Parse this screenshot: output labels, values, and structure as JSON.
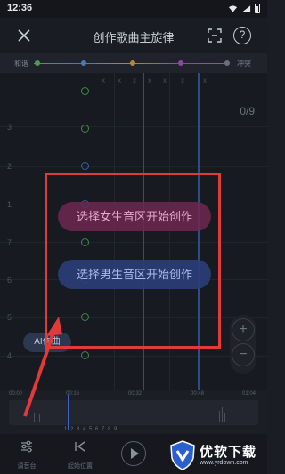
{
  "status_bar": {
    "time": "12:36"
  },
  "header": {
    "title": "创作歌曲主旋律"
  },
  "mood_bar": {
    "left_label": "和谐",
    "right_label": "冲突"
  },
  "staff": {
    "counter": "0/9",
    "row_numbers": [
      "3",
      "2",
      "1",
      "7",
      "6",
      "5",
      "4"
    ],
    "x_marks": [
      "x",
      "x",
      "x",
      "x",
      "x",
      "x",
      "x"
    ]
  },
  "prompts": {
    "female": "选择女生音区开始创作",
    "male": "选择男生音区开始创作"
  },
  "ai_button": "AI作曲",
  "zoom": {
    "plus": "+",
    "minus": "−"
  },
  "timeline": {
    "ticks": [
      "00:00",
      "00:16",
      "00:32",
      "00:48",
      "01:04"
    ],
    "numbers": "1 2 3 4 5 6 7 8 9"
  },
  "toolbar": {
    "adjust_label": "调音台",
    "start_label": "起始位置"
  },
  "watermark": {
    "name": "优软下载",
    "url": "www.yrdown.com"
  },
  "colors": {
    "highlight_box": "#e03a3a",
    "playhead": "#3f63c9"
  }
}
